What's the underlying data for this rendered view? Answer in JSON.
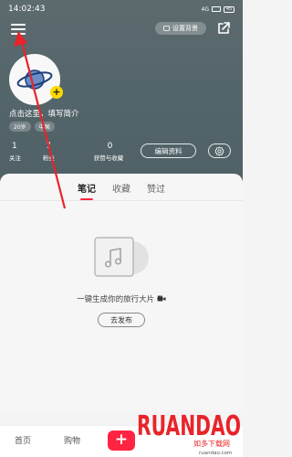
{
  "status_bar": {
    "time": "14:02:43",
    "signal_label": "4G",
    "battery": "45"
  },
  "header": {
    "background_button_label": "设置背景"
  },
  "profile": {
    "bio": "点击这里，填写简介",
    "tags": [
      "20岁",
      "中国"
    ],
    "stats": [
      {
        "value": "1",
        "label": "关注"
      },
      {
        "value": "7",
        "label": "粉丝"
      },
      {
        "value": "0",
        "label": "获赞与收藏"
      }
    ],
    "edit_button": "编辑资料"
  },
  "tabs": [
    "笔记",
    "收藏",
    "赞过"
  ],
  "empty_state": {
    "text": "一键生成你的旅行大片",
    "button": "去发布"
  },
  "bottom_nav": {
    "home": "首页",
    "shop": "购物",
    "plus": "+"
  },
  "watermark": {
    "brand": "RUANDAO",
    "sub": "如多下载网",
    "url": "ruandao.com"
  },
  "colors": {
    "header_bg": "#55666b",
    "accent": "#ff2442",
    "avatar_badge": "#ffd800"
  }
}
